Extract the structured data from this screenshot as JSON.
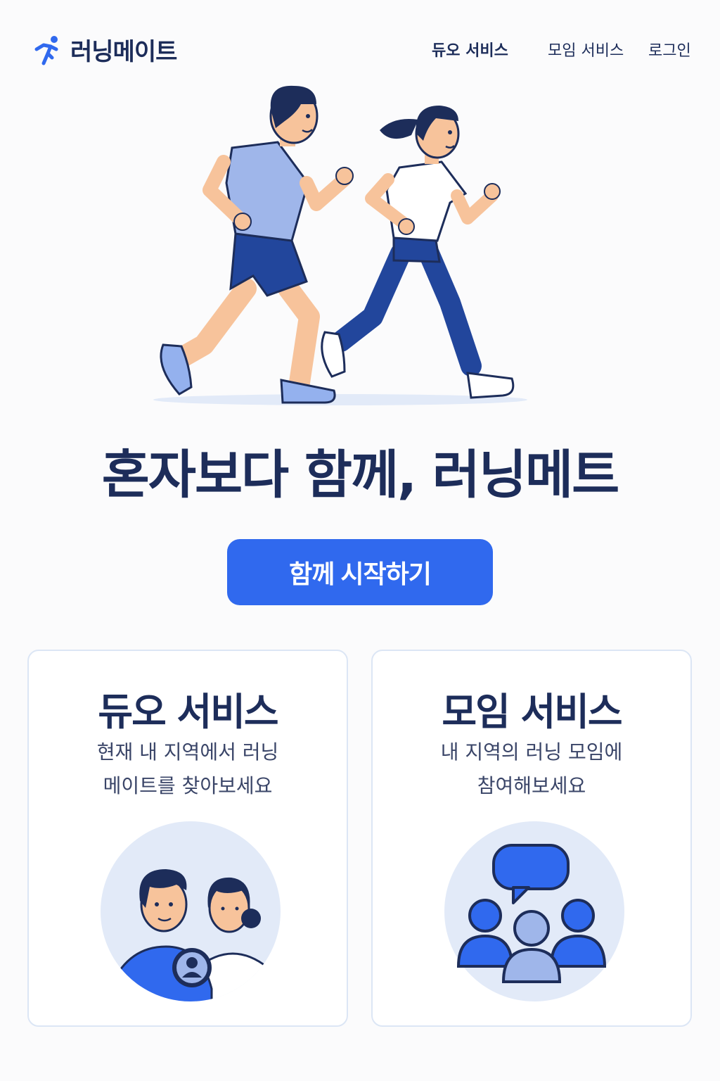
{
  "brand": {
    "name": "러닝메이트",
    "accent": "#3069ee",
    "dark": "#1d2d5a"
  },
  "nav": {
    "duo": "듀오 서비스",
    "meetup": "모임 서비스",
    "login": "로그인"
  },
  "hero": {
    "headline": "혼자보다 함께, 러닝메트",
    "cta": "함께 시작하기"
  },
  "cards": {
    "duo": {
      "title": "듀오 서비스",
      "desc_line1": "현재 내 지역에서 러닝",
      "desc_line2": "메이트를 찾아보세요"
    },
    "meetup": {
      "title": "모임 서비스",
      "desc_line1": "내 지역의 러닝 모임에",
      "desc_line2": "참여해보세요"
    }
  },
  "icons": {
    "logo": "runner-icon",
    "duo": "two-people-icon",
    "meetup": "group-chat-icon"
  }
}
